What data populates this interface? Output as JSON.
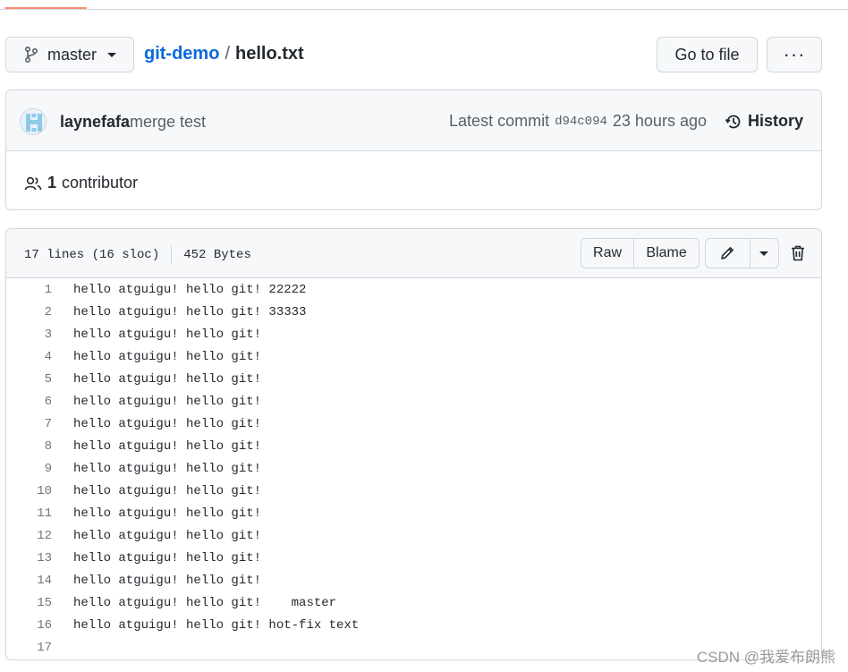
{
  "nav": {
    "active_tab_color": "#fd8c73"
  },
  "branch": {
    "icon": "git-branch-icon",
    "label": "master"
  },
  "breadcrumb": {
    "repo": "git-demo",
    "separator": "/",
    "file": "hello.txt"
  },
  "actions": {
    "go_to_file": "Go to file",
    "more": "···"
  },
  "commit": {
    "author": "laynefafa",
    "message": "merge test",
    "latest_label": "Latest commit",
    "sha": "d94c094",
    "time": "23 hours ago",
    "history_label": "History"
  },
  "contributors": {
    "count": "1",
    "label": "contributor"
  },
  "file": {
    "lines_info": "17 lines (16 sloc)",
    "size": "452 Bytes",
    "raw_label": "Raw",
    "blame_label": "Blame",
    "lines": [
      {
        "n": "1",
        "text": "hello atguigu! hello git! 22222"
      },
      {
        "n": "2",
        "text": "hello atguigu! hello git! 33333"
      },
      {
        "n": "3",
        "text": "hello atguigu! hello git!"
      },
      {
        "n": "4",
        "text": "hello atguigu! hello git!"
      },
      {
        "n": "5",
        "text": "hello atguigu! hello git!"
      },
      {
        "n": "6",
        "text": "hello atguigu! hello git!"
      },
      {
        "n": "7",
        "text": "hello atguigu! hello git!"
      },
      {
        "n": "8",
        "text": "hello atguigu! hello git!"
      },
      {
        "n": "9",
        "text": "hello atguigu! hello git!"
      },
      {
        "n": "10",
        "text": "hello atguigu! hello git!"
      },
      {
        "n": "11",
        "text": "hello atguigu! hello git!"
      },
      {
        "n": "12",
        "text": "hello atguigu! hello git!"
      },
      {
        "n": "13",
        "text": "hello atguigu! hello git!"
      },
      {
        "n": "14",
        "text": "hello atguigu! hello git!"
      },
      {
        "n": "15",
        "text": "hello atguigu! hello git!    master"
      },
      {
        "n": "16",
        "text": "hello atguigu! hello git! hot-fix text"
      },
      {
        "n": "17",
        "text": ""
      }
    ]
  },
  "watermark": "CSDN @我爱布朗熊",
  "colors": {
    "link": "#0969da",
    "border": "#d0d7de",
    "header_bg": "#f6f8fa"
  }
}
